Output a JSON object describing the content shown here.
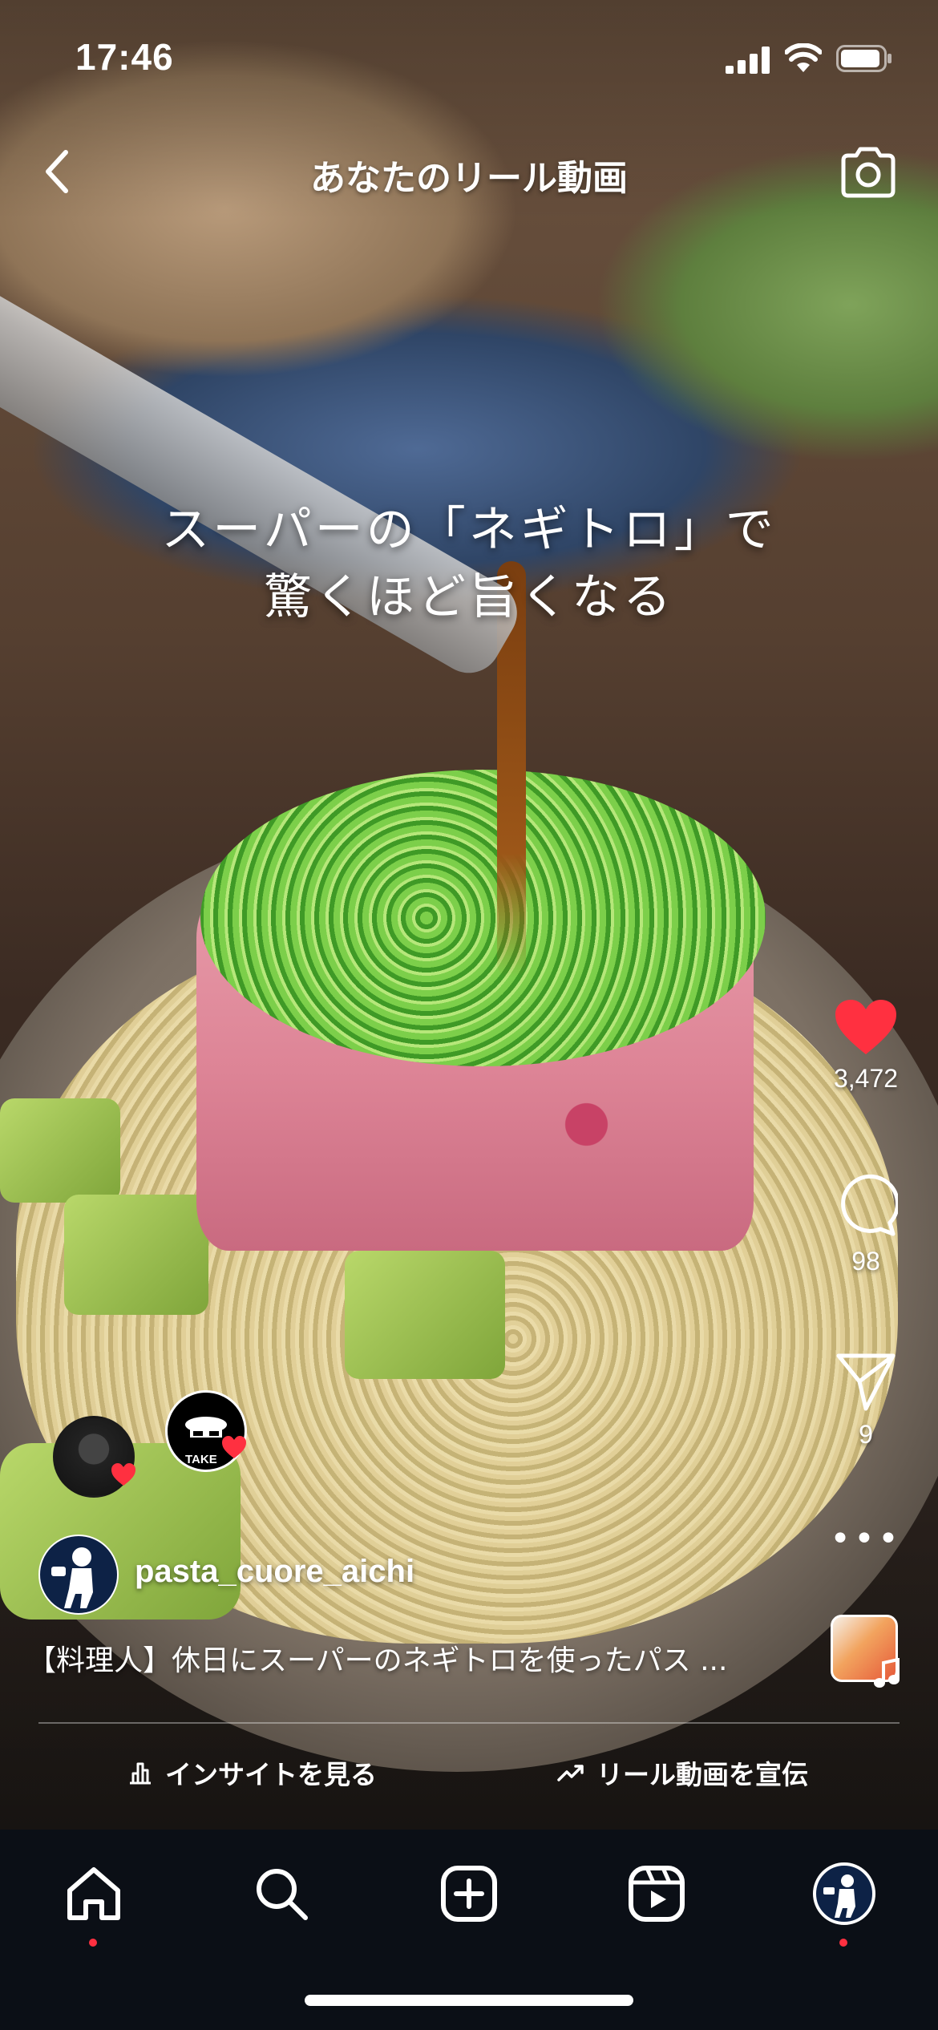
{
  "status_bar": {
    "time": "17:46"
  },
  "header": {
    "title": "あなたのリール動画"
  },
  "reel": {
    "caption_lines": [
      "スーパーの「ネギトロ」で",
      "驚くほど旨くなる"
    ],
    "likes": "3,472",
    "comments": "98",
    "shares": "9",
    "collaborator_badge": "TAKE",
    "author": "pasta_cuore_aichi",
    "description": "【料理人】休日にスーパーのネギトロを使ったパス ..."
  },
  "bottom_actions": {
    "insights_label": "インサイトを見る",
    "promote_label": "リール動画を宣伝"
  },
  "tabs": [
    "home-icon",
    "search-icon",
    "create-icon",
    "reels-icon",
    "profile-avatar"
  ],
  "colors": {
    "like": "#ff3040",
    "tabbar": "#0b0f16",
    "notification_dot": "#ff3040"
  }
}
